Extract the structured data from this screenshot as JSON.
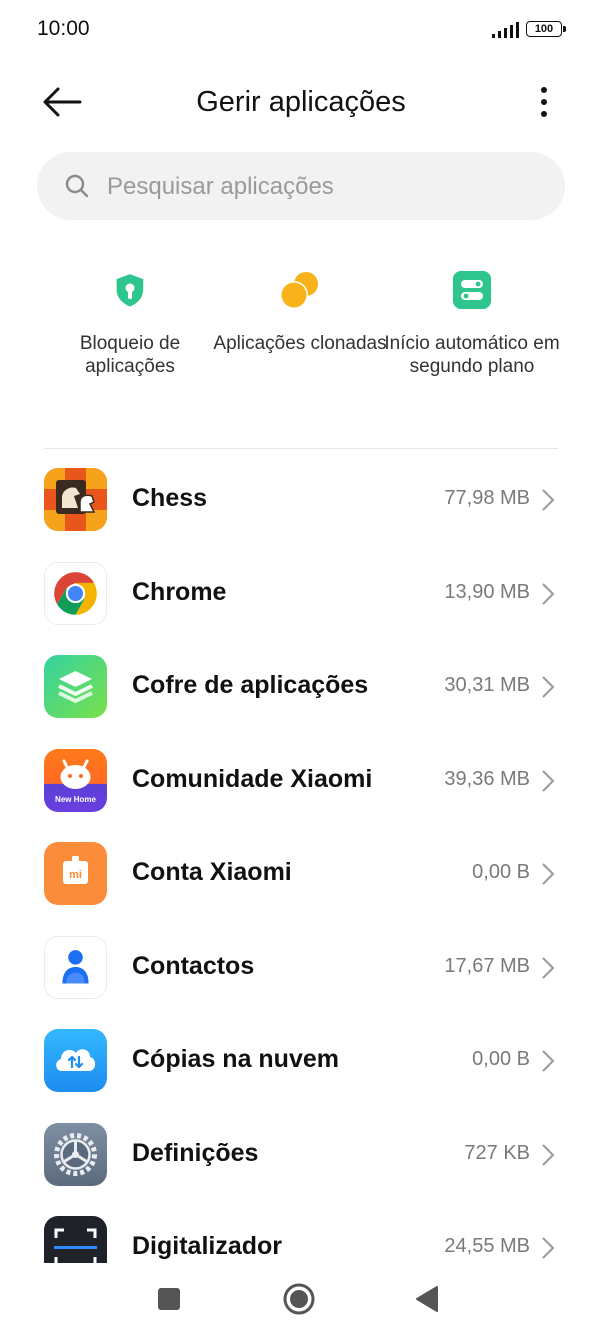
{
  "status_bar": {
    "time": "10:00",
    "battery": "100"
  },
  "header": {
    "title": "Gerir aplicações"
  },
  "search": {
    "placeholder": "Pesquisar aplicações"
  },
  "quick_actions": [
    {
      "label": "Bloqueio de aplicações",
      "icon": "shield-lock-icon",
      "color": "#2ec58f"
    },
    {
      "label": "Aplicações clonadas",
      "icon": "clone-circles-icon",
      "color": "#f9b219"
    },
    {
      "label": "Início automático em segundo plano",
      "icon": "toggle-switches-icon",
      "color": "#2ec58f"
    }
  ],
  "apps": [
    {
      "name": "Chess",
      "size": "77,98 MB",
      "icon": "chess-icon"
    },
    {
      "name": "Chrome",
      "size": "13,90 MB",
      "icon": "chrome-icon"
    },
    {
      "name": "Cofre de aplicações",
      "size": "30,31 MB",
      "icon": "app-vault-icon"
    },
    {
      "name": "Comunidade Xiaomi",
      "size": "39,36 MB",
      "icon": "xiaomi-community-icon",
      "badge": "New Home"
    },
    {
      "name": "Conta Xiaomi",
      "size": "0,00 B",
      "icon": "xiaomi-account-icon"
    },
    {
      "name": "Contactos",
      "size": "17,67 MB",
      "icon": "contacts-icon"
    },
    {
      "name": "Cópias na nuvem",
      "size": "0,00 B",
      "icon": "cloud-backup-icon"
    },
    {
      "name": "Definições",
      "size": "727 KB",
      "icon": "settings-icon"
    },
    {
      "name": "Digitalizador",
      "size": "24,55 MB",
      "icon": "scanner-icon"
    }
  ],
  "colors": {
    "accent_green": "#2ec58f",
    "accent_orange": "#f9b219"
  }
}
